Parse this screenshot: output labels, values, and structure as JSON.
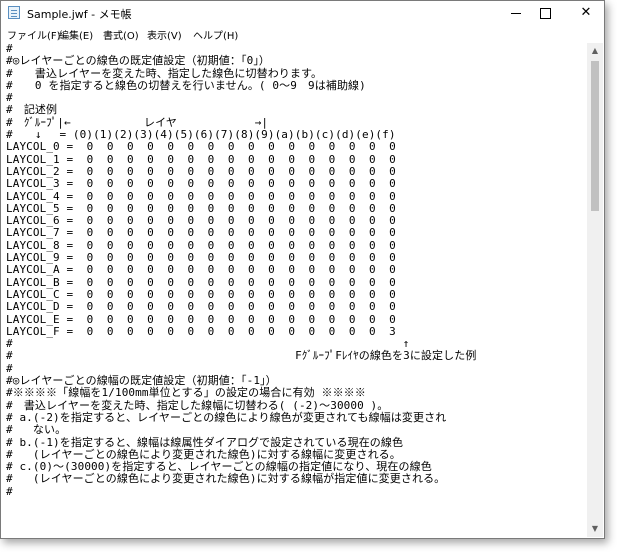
{
  "window": {
    "title": "Sample.jwf - メモ帳",
    "minimize_glyph": "",
    "maximize_glyph": "",
    "close_glyph": "✕"
  },
  "menu": [
    {
      "label": "ファイル(F)"
    },
    {
      "label": "編集(E)"
    },
    {
      "label": "書式(O)"
    },
    {
      "label": "表示(V)"
    },
    {
      "label": "ヘルプ(H)"
    }
  ],
  "scrollbar": {
    "up_glyph": "▲",
    "down_glyph": "▼"
  },
  "editor": {
    "lines": [
      "#",
      "#◎レイヤーごとの線色の既定値設定（初期値：「0」）",
      "#　　書込レイヤーを変えた時、指定した線色に切替わります。",
      "#　　0 を指定すると線色の切替えを行いません。( 0～9　9は補助線)",
      "#",
      "#　記述例",
      "#　ｸﾞﾙｰﾌﾟ|←　　　　　　 レイヤ　　　　　　　→|",
      "#　　↓　 = (0)(1)(2)(3)(4)(5)(6)(7)(8)(9)(a)(b)(c)(d)(e)(f)",
      "LAYCOL_0 =  0  0  0  0  0  0  0  0  0  0  0  0  0  0  0  0",
      "LAYCOL_1 =  0  0  0  0  0  0  0  0  0  0  0  0  0  0  0  0",
      "LAYCOL_2 =  0  0  0  0  0  0  0  0  0  0  0  0  0  0  0  0",
      "LAYCOL_3 =  0  0  0  0  0  0  0  0  0  0  0  0  0  0  0  0",
      "LAYCOL_4 =  0  0  0  0  0  0  0  0  0  0  0  0  0  0  0  0",
      "LAYCOL_5 =  0  0  0  0  0  0  0  0  0  0  0  0  0  0  0  0",
      "LAYCOL_6 =  0  0  0  0  0  0  0  0  0  0  0  0  0  0  0  0",
      "LAYCOL_7 =  0  0  0  0  0  0  0  0  0  0  0  0  0  0  0  0",
      "LAYCOL_8 =  0  0  0  0  0  0  0  0  0  0  0  0  0  0  0  0",
      "LAYCOL_9 =  0  0  0  0  0  0  0  0  0  0  0  0  0  0  0  0",
      "LAYCOL_A =  0  0  0  0  0  0  0  0  0  0  0  0  0  0  0  0",
      "LAYCOL_B =  0  0  0  0  0  0  0  0  0  0  0  0  0  0  0  0",
      "LAYCOL_C =  0  0  0  0  0  0  0  0  0  0  0  0  0  0  0  0",
      "LAYCOL_D =  0  0  0  0  0  0  0  0  0  0  0  0  0  0  0  0",
      "LAYCOL_E =  0  0  0  0  0  0  0  0  0  0  0  0  0  0  0  0",
      "LAYCOL_F =  0  0  0  0  0  0  0  0  0  0  0  0  0  0  0  3",
      "#                                                          ↑",
      "#                                          FｸﾞﾙｰﾌﾟFﾚｲﾔの線色を3に設定した例",
      "#",
      "#◎レイヤーごとの線幅の既定値設定（初期値：「-1」）",
      "#※※※※「線幅を1/100mm単位とする」の設定の場合に有効 ※※※※",
      "#　書込レイヤーを変えた時、指定した線幅に切替わる( (-2)～30000 )。",
      "# a.(-2)を指定すると、レイヤーごとの線色により線色が変更されても線幅は変更され",
      "#   ない。",
      "# b.(-1)を指定すると、線幅は線属性ダイアログで設定されている現在の線色",
      "#   (レイヤーごとの線色により変更された線色)に対する線幅に変更される。",
      "# c.(0)～(30000)を指定すると、レイヤーごとの線幅の指定値になり、現在の線色",
      "#   (レイヤーごとの線色により変更された線色)に対する線幅が指定値に変更される。",
      "#"
    ]
  }
}
